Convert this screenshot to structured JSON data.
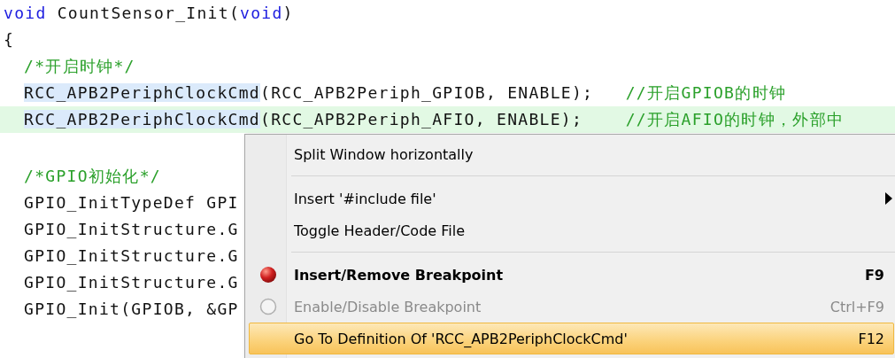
{
  "code": {
    "header": [
      {
        "current_line": false,
        "segments": [
          {
            "kind": "keyword",
            "text": "void",
            "highlighted": false
          },
          {
            "kind": "plain",
            "text": " CountSensor_Init(",
            "highlighted": false
          },
          {
            "kind": "keyword",
            "text": "void",
            "highlighted": false
          },
          {
            "kind": "plain",
            "text": ")",
            "highlighted": false
          }
        ]
      },
      {
        "current_line": false,
        "segments": [
          {
            "kind": "plain",
            "text": "{",
            "highlighted": false
          }
        ]
      }
    ],
    "body_groups": [
      [
        {
          "current_line": false,
          "segments": [
            {
              "kind": "comment",
              "text": "/*开启时钟*/",
              "highlighted": false
            }
          ]
        },
        {
          "current_line": false,
          "segments": [
            {
              "kind": "plain",
              "text": "RCC_APB2PeriphClockCmd",
              "highlighted": true
            },
            {
              "kind": "plain",
              "text": "(RCC_APB2Periph_GPIOB, ENABLE);   ",
              "highlighted": false
            },
            {
              "kind": "comment",
              "text": "//开启GPIOB的时钟",
              "highlighted": false
            }
          ]
        },
        {
          "current_line": true,
          "segments": [
            {
              "kind": "plain",
              "text": "RCC_APB2PeriphClockCmd",
              "highlighted": true
            },
            {
              "kind": "plain",
              "text": "(RCC_APB2Periph_AFIO, ENABLE);    ",
              "highlighted": false
            },
            {
              "kind": "comment",
              "text": "//开启AFIO的时钟，外部中",
              "highlighted": false
            }
          ]
        }
      ],
      [
        {
          "current_line": false,
          "segments": [
            {
              "kind": "comment",
              "text": "/*GPIO初始化*/",
              "highlighted": false
            }
          ]
        },
        {
          "current_line": false,
          "segments": [
            {
              "kind": "plain",
              "text": "GPIO_InitTypeDef GPI",
              "highlighted": false
            }
          ]
        },
        {
          "current_line": false,
          "segments": [
            {
              "kind": "plain",
              "text": "GPIO_InitStructure.G",
              "highlighted": false
            }
          ]
        },
        {
          "current_line": false,
          "segments": [
            {
              "kind": "plain",
              "text": "GPIO_InitStructure.G",
              "highlighted": false
            }
          ]
        },
        {
          "current_line": false,
          "segments": [
            {
              "kind": "plain",
              "text": "GPIO_InitStructure.G",
              "highlighted": false
            }
          ]
        },
        {
          "current_line": false,
          "segments": [
            {
              "kind": "plain",
              "text": "GPIO_Init(GPIOB, &GP",
              "highlighted": false
            }
          ]
        }
      ]
    ]
  },
  "context_menu": {
    "items": [
      {
        "kind": "item",
        "label": "Split Window horizontally",
        "selected": false,
        "disabled": false,
        "bold": false,
        "submenu": false,
        "breakpoint_icon": false
      },
      {
        "kind": "separator"
      },
      {
        "kind": "item",
        "label": "Insert '#include file'",
        "selected": false,
        "disabled": false,
        "bold": false,
        "submenu": true,
        "breakpoint_icon": false
      },
      {
        "kind": "item",
        "label": "Toggle Header/Code File",
        "selected": false,
        "disabled": false,
        "bold": false,
        "submenu": false,
        "breakpoint_icon": false
      },
      {
        "kind": "separator"
      },
      {
        "kind": "item",
        "label": "Insert/Remove Breakpoint",
        "shortcut": "F9",
        "selected": false,
        "disabled": false,
        "bold": true,
        "submenu": false,
        "breakpoint_icon": true
      },
      {
        "kind": "item",
        "label": "Enable/Disable Breakpoint",
        "shortcut": "Ctrl+F9",
        "selected": false,
        "disabled": true,
        "bold": false,
        "submenu": false,
        "breakpoint_icon": true
      },
      {
        "kind": "item",
        "label": "Go To Definition Of 'RCC_APB2PeriphClockCmd'",
        "shortcut": "F12",
        "selected": true,
        "disabled": false,
        "bold": false,
        "submenu": false,
        "breakpoint_icon": false
      }
    ]
  }
}
